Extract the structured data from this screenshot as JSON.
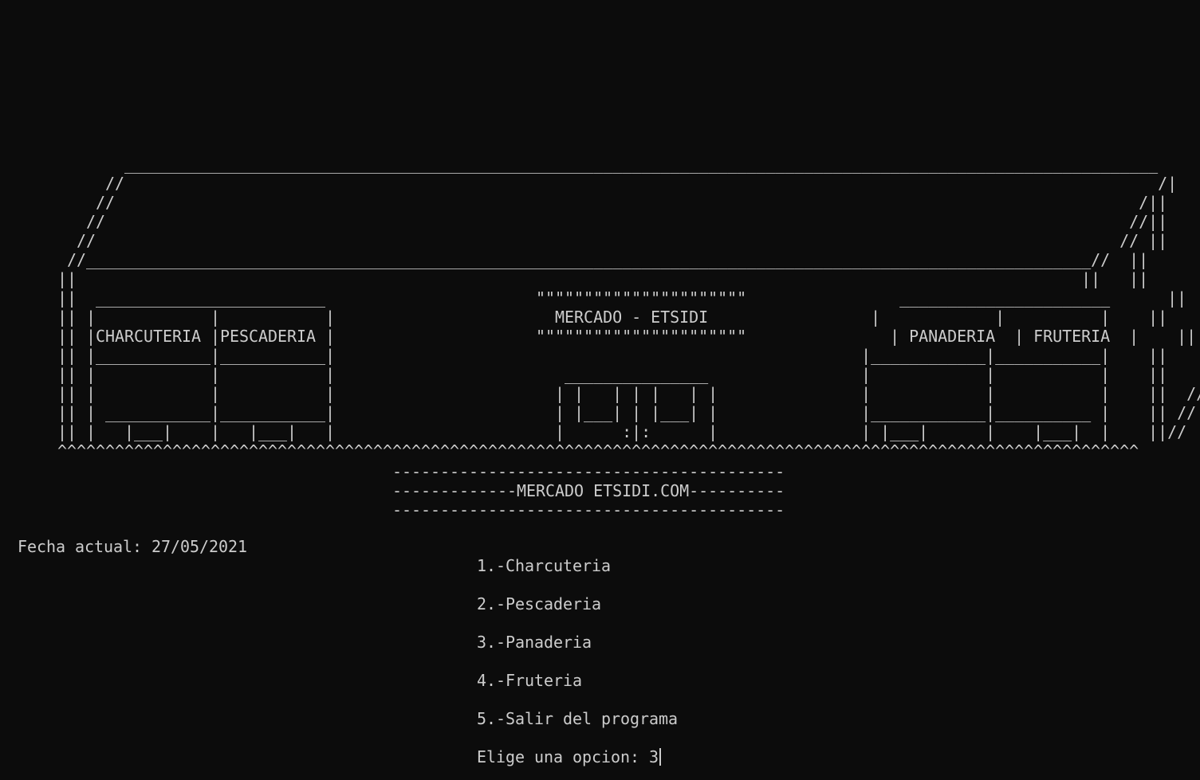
{
  "window": {
    "type": "console",
    "background": "#0c0c0c",
    "foreground": "#cccccc"
  },
  "banner": {
    "art_lines": [
      "             ____________________________________________________________________________________________________________",
      "           //                                                                                                            /|",
      "          //                                                                                                           /||",
      "         //                                                                                                           //||",
      "        //                                                                                                           // ||",
      "       //_________________________________________________________________________________________________________//  ||",
      "      ||                                                                                                         ||   ||",
      "      ||  ________________________                      \"\"\"\"\"\"\"\"\"\"\"\"\"\"\"\"\"\"\"\"\"\"                ______________________      ||   ||",
      "      || |            |           |                       MERCADO - ETSIDI                 |            |          |    ||   ||",
      "      || |CHARCUTERIA |PESCADERIA |                     \"\"\"\"\"\"\"\"\"\"\"\"\"\"\"\"\"\"\"\"\"\"               | PANADERIA  | FRUTERIA  |    ||   ||",
      "      || |____________|___________|                                                       |____________|___________|    ||   ||",
      "      || |            |           |                        _______________                |            |           |    ||   ||",
      "      || |            |           |                       | |   | | |   | |               |            |           |    ||  //",
      "      || | ___________|___________|                       | |___| | |___| |               |____________|__________ |    || //",
      "      || |   |___|    |   |___|   |                       |      :|:      |               | |___|      |    |___|  |    ||//",
      "      ^^^^^^^^^^^^^^^^^^^^^^^^^^^^^^^^^^^^^^^^^^^^^^^^^^^^^^^^^^^^^^^^^^^^^^^^^^^^^^^^^^^^^^^^^^^^^^^^^^^^^^^^^^^^^^^^^",
      "                                         -----------------------------------------",
      "                                         -------------MERCADO ETSIDI.COM----------",
      "                                         -----------------------------------------"
    ]
  },
  "status": {
    "date_text": "Fecha actual: 27/05/2021"
  },
  "menu": {
    "items": [
      "1.-Charcuteria",
      "2.-Pescaderia",
      "3.-Panaderia",
      "4.-Fruteria",
      "5.-Salir del programa"
    ]
  },
  "prompt": {
    "label": "Elige una opcion: ",
    "input_value": "3"
  }
}
